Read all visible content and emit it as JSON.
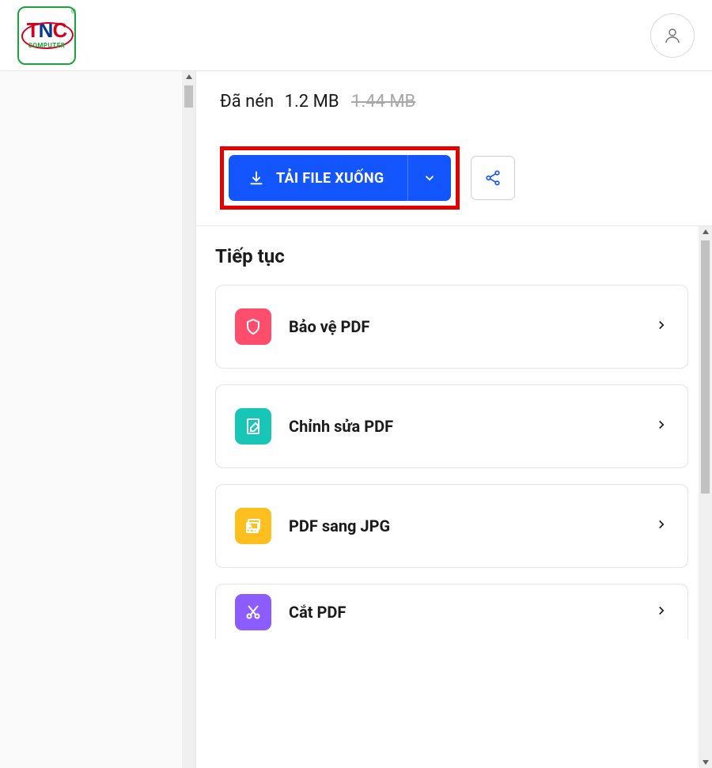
{
  "logo": {
    "main_t": "T",
    "main_n": "N",
    "main_c": "C",
    "sub": "COMPUTER"
  },
  "compress": {
    "label": "Đã nén",
    "compressed_size": "1.2 MB",
    "original_size": "1.44 MB"
  },
  "download_button": {
    "label": "TẢI FILE XUỐNG"
  },
  "continue": {
    "title": "Tiếp tục",
    "actions": [
      {
        "label": "Bảo vệ PDF",
        "icon": "shield",
        "color": "pink"
      },
      {
        "label": "Chỉnh sửa PDF",
        "icon": "edit",
        "color": "teal"
      },
      {
        "label": "PDF sang JPG",
        "icon": "image",
        "color": "yellow"
      },
      {
        "label": "Cắt PDF",
        "icon": "scissors",
        "color": "purple"
      }
    ]
  }
}
